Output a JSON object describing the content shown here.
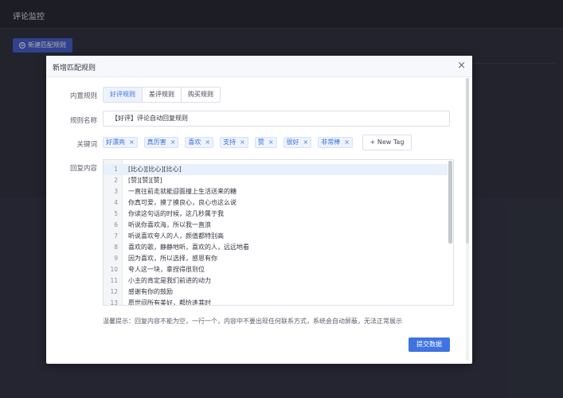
{
  "page": {
    "title": "评论监控",
    "new_rule_button": "新建匹配规则"
  },
  "modal": {
    "title": "新增匹配规则",
    "close": "×",
    "labels": {
      "builtin": "内置规则",
      "name": "规则名称",
      "keywords": "关键词",
      "content": "回复内容"
    },
    "builtin_options": [
      "好评规则",
      "差评规则",
      "购买规则"
    ],
    "builtin_selected": "好评规则",
    "name_value": "【好评】评论自动回复规则",
    "keywords": [
      "好漂亮",
      "真厉害",
      "喜欢",
      "支持",
      "赞",
      "很好",
      "非常棒"
    ],
    "new_tag_label": "+ New Tag",
    "content_lines": [
      "[比心][比心][比心]",
      "[赞][赞][赞]",
      "一直往前走就能迎面撞上生活送来的糖",
      "你真可爱，摸了摸良心，良心也这么说",
      "你读这句话的时候，这几秒属于我",
      "听说你喜欢海，所以我一直浪",
      "听说喜欢夸人的人，颜值都特别高",
      "喜欢的歌，静静地听，喜欢的人，远远地看",
      "因为喜欢，所以选择，感恩有你",
      "夸人这一块，拿捏得很到位",
      "小主的肯定是我们前进的动力",
      "感谢有你的鼓励",
      "愿世间所有美好，都恰逢其时"
    ],
    "tip": "温馨提示：回复内容不能为空，一行一个，内容中不要出现任何联系方式，系统会自动屏蔽，无法正常展示",
    "submit_label": "提交数据"
  }
}
